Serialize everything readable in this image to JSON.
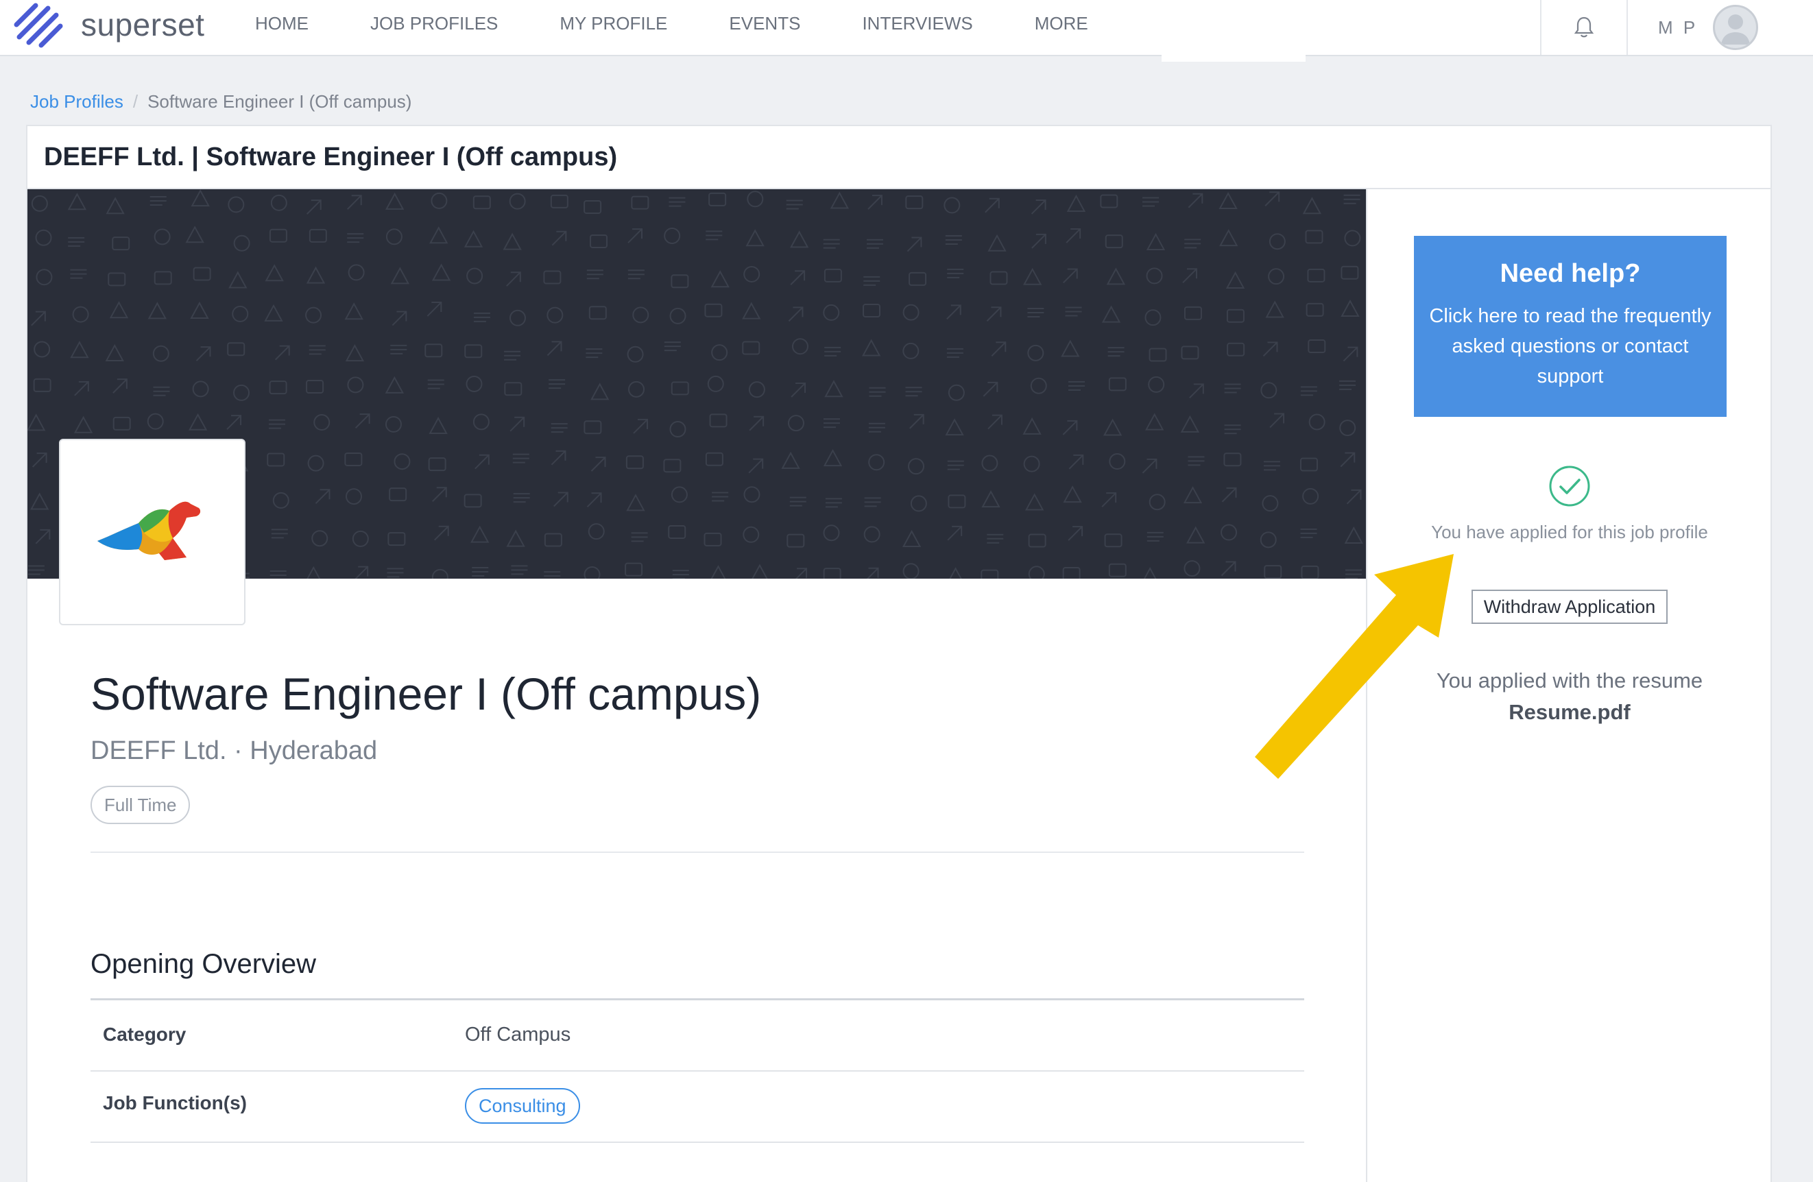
{
  "nav": {
    "brand": "superset",
    "items": [
      "HOME",
      "JOB PROFILES",
      "MY PROFILE",
      "EVENTS",
      "INTERVIEWS",
      "MORE"
    ],
    "user_initials": "M P"
  },
  "breadcrumb": {
    "link": "Job Profiles",
    "separator": "/",
    "current": "Software Engineer I (Off campus)"
  },
  "card": {
    "header_title": "DEEFF Ltd. | Software Engineer I (Off campus)",
    "job_title": "Software Engineer I (Off campus)",
    "company_location": "DEEFF Ltd. · Hyderabad",
    "employment_tag": "Full Time"
  },
  "overview": {
    "title": "Opening Overview",
    "rows": [
      {
        "label": "Category",
        "value": "Off Campus"
      },
      {
        "label": "Job Function(s)",
        "value": "Consulting"
      }
    ]
  },
  "sidebar": {
    "help_title": "Need help?",
    "help_text": "Click here to read the frequently asked questions or contact support",
    "applied_text": "You have applied for this job profile",
    "withdraw_label": "Withdraw Application",
    "resume_text": "You applied with the resume",
    "resume_name": "Resume.pdf"
  },
  "colors": {
    "accent": "#4a90e2",
    "link": "#3a8ee6",
    "success": "#3cb98a",
    "annotation": "#f5c400",
    "banner": "#2a2e39"
  },
  "icons": {
    "bell": "bell-icon",
    "avatar": "user-avatar-icon",
    "check": "check-circle-icon",
    "arrow": "annotation-arrow"
  }
}
